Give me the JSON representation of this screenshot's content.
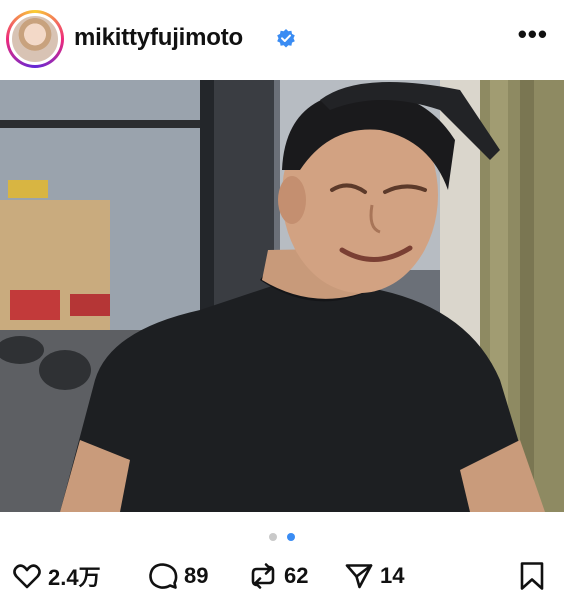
{
  "header": {
    "username": "mikittyfujimoto",
    "verified": true,
    "more_icon": "more-horizontal-icon",
    "more_label": "•••"
  },
  "post": {
    "carousel": {
      "total": 2,
      "active_index": 2
    }
  },
  "actions": {
    "likes": "2.4万",
    "comments": "89",
    "reposts": "62",
    "shares": "14"
  },
  "colors": {
    "accent_blue": "#3a8cf3",
    "text": "#111111"
  }
}
